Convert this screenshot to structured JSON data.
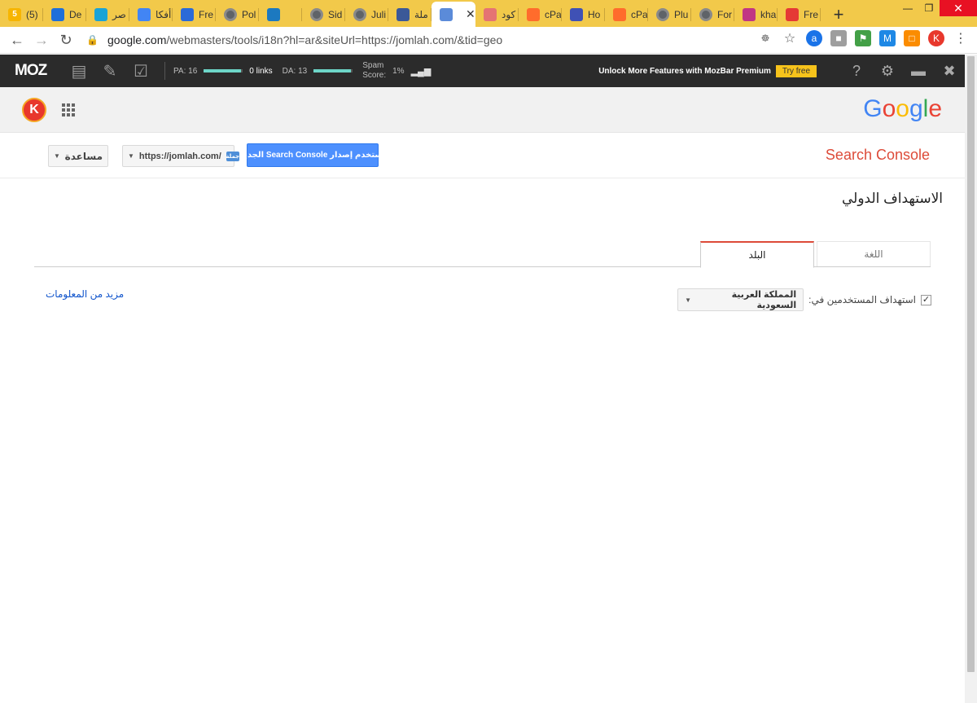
{
  "browser": {
    "tabs": [
      {
        "label": "(5)",
        "icon": "number-badge-icon",
        "color": "#f7b500",
        "badge": "5"
      },
      {
        "label": "De",
        "icon": "jomlah-favicon",
        "color": "#1e6fd9",
        "badge": ""
      },
      {
        "label": "صر",
        "icon": "target-icon",
        "color": "#1aa3d6",
        "badge": ""
      },
      {
        "label": "أفكا",
        "icon": "adsense-icon",
        "color": "#4285f4",
        "badge": ""
      },
      {
        "label": "Fre",
        "icon": "hand-icon",
        "color": "#2a6ad8",
        "badge": ""
      },
      {
        "label": "Pol",
        "icon": "globe-icon",
        "color": "#666666",
        "badge": ""
      },
      {
        "label": "",
        "icon": "card-icon",
        "color": "#1c79c0",
        "badge": ""
      },
      {
        "label": "Sid",
        "icon": "globe-icon",
        "color": "#666666",
        "badge": ""
      },
      {
        "label": "Juli",
        "icon": "globe-icon",
        "color": "#666666",
        "badge": ""
      },
      {
        "label": "ملة",
        "icon": "store-icon",
        "color": "#3b5998",
        "badge": ""
      },
      {
        "label": "",
        "icon": "search-console-icon",
        "color": "#5b8bd9",
        "badge": ""
      },
      {
        "label": "كود",
        "icon": "coupon-icon",
        "color": "#e57373",
        "badge": ""
      },
      {
        "label": "cPa",
        "icon": "cpanel-icon",
        "color": "#ff6c2c",
        "badge": ""
      },
      {
        "label": "Ho",
        "icon": "grid-icon",
        "color": "#3f51b5",
        "badge": ""
      },
      {
        "label": "cPa",
        "icon": "cpanel-icon",
        "color": "#ff6c2c",
        "badge": ""
      },
      {
        "label": "Plu",
        "icon": "globe-icon",
        "color": "#666666",
        "badge": ""
      },
      {
        "label": "For",
        "icon": "globe-icon",
        "color": "#666666",
        "badge": ""
      },
      {
        "label": "kha",
        "icon": "instagram-icon",
        "color": "#c13584",
        "badge": ""
      },
      {
        "label": "Fre",
        "icon": "gift-icon",
        "color": "#e53935",
        "badge": ""
      }
    ],
    "active_tab_index": 10,
    "new_tab": "+",
    "url_host": "google.com",
    "url_rest": "/webmasters/tools/i18n?hl=ar&siteUrl=https://jomlah.com/&tid=geo"
  },
  "mozbar": {
    "logo": "MOZ",
    "pa_label": "PA: 16",
    "pa_fill": 0.95,
    "links_label": "0 links",
    "da_label": "DA: 13",
    "da_fill": 0.95,
    "spam_label_1": "Spam",
    "spam_label_2": "Score:",
    "spam_value": "1%",
    "unlock_text": "Unlock More Features with MozBar Premium",
    "try_free": "Try free",
    "help": "?"
  },
  "google": {
    "avatar_letter": "K",
    "logo_letters": [
      {
        "ch": "G",
        "color": "#4285f4"
      },
      {
        "ch": "o",
        "color": "#ea4335"
      },
      {
        "ch": "o",
        "color": "#fbbc05"
      },
      {
        "ch": "g",
        "color": "#4285f4"
      },
      {
        "ch": "l",
        "color": "#34a853"
      },
      {
        "ch": "e",
        "color": "#ea4335"
      }
    ]
  },
  "console": {
    "title": "Search Console",
    "help_label": "مساعدة",
    "site_label": "https://jomlah.com/",
    "site_favicon": "جملة",
    "new_version": "استخدم إصدار Search Console الجديد",
    "page_title": "الاستهداف الدولي",
    "tab_language": "اللغة",
    "tab_country": "البلد",
    "target_label": "استهداف المستخدمين في:",
    "target_checked": true,
    "country_value": "المملكة العربية السعودية",
    "more_info": "مزيد من المعلومات"
  }
}
